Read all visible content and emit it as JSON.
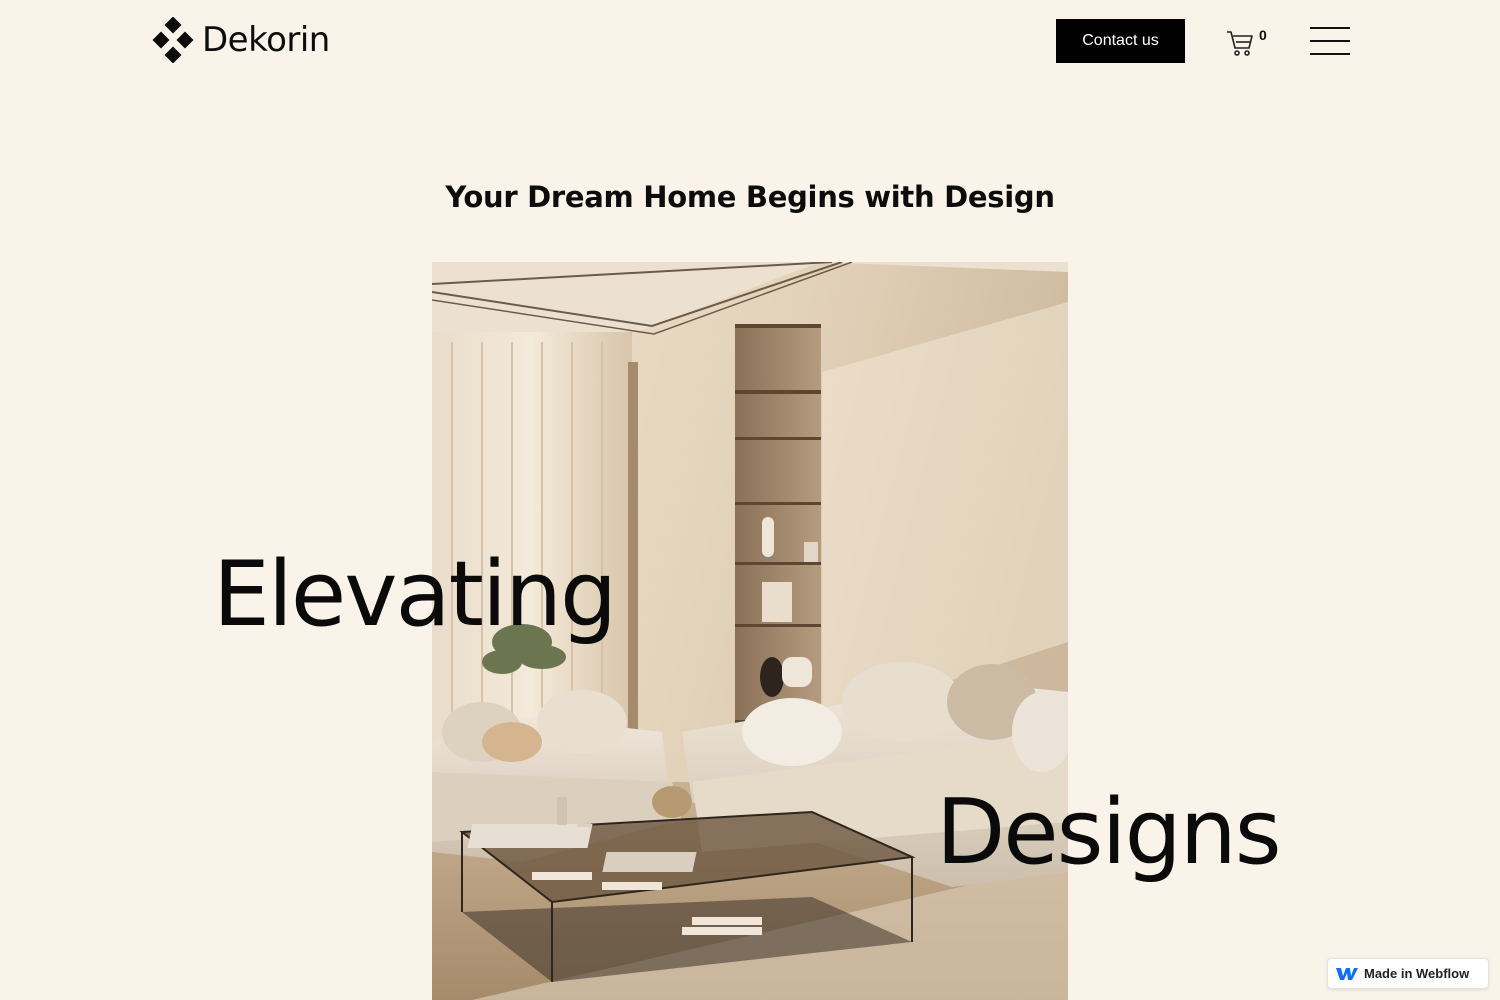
{
  "header": {
    "brand": "Dekorin",
    "contact_label": "Contact us",
    "cart_count": "0",
    "logo_icon": "diamond-cluster-icon",
    "cart_icon": "cart-icon",
    "menu_icon": "hamburger-menu-icon"
  },
  "hero": {
    "tagline": "Your Dream Home Begins with Design",
    "word_1": "Elevating",
    "word_2": "Designs",
    "image_icon": "living-room-photo"
  },
  "badge": {
    "label": "Made in Webflow",
    "icon": "webflow-logo-icon"
  },
  "colors": {
    "background": "#faf3ea",
    "text": "#0c0c0c",
    "button_bg": "#000000",
    "button_text": "#ffffff",
    "webflow_blue": "#146ef5"
  }
}
